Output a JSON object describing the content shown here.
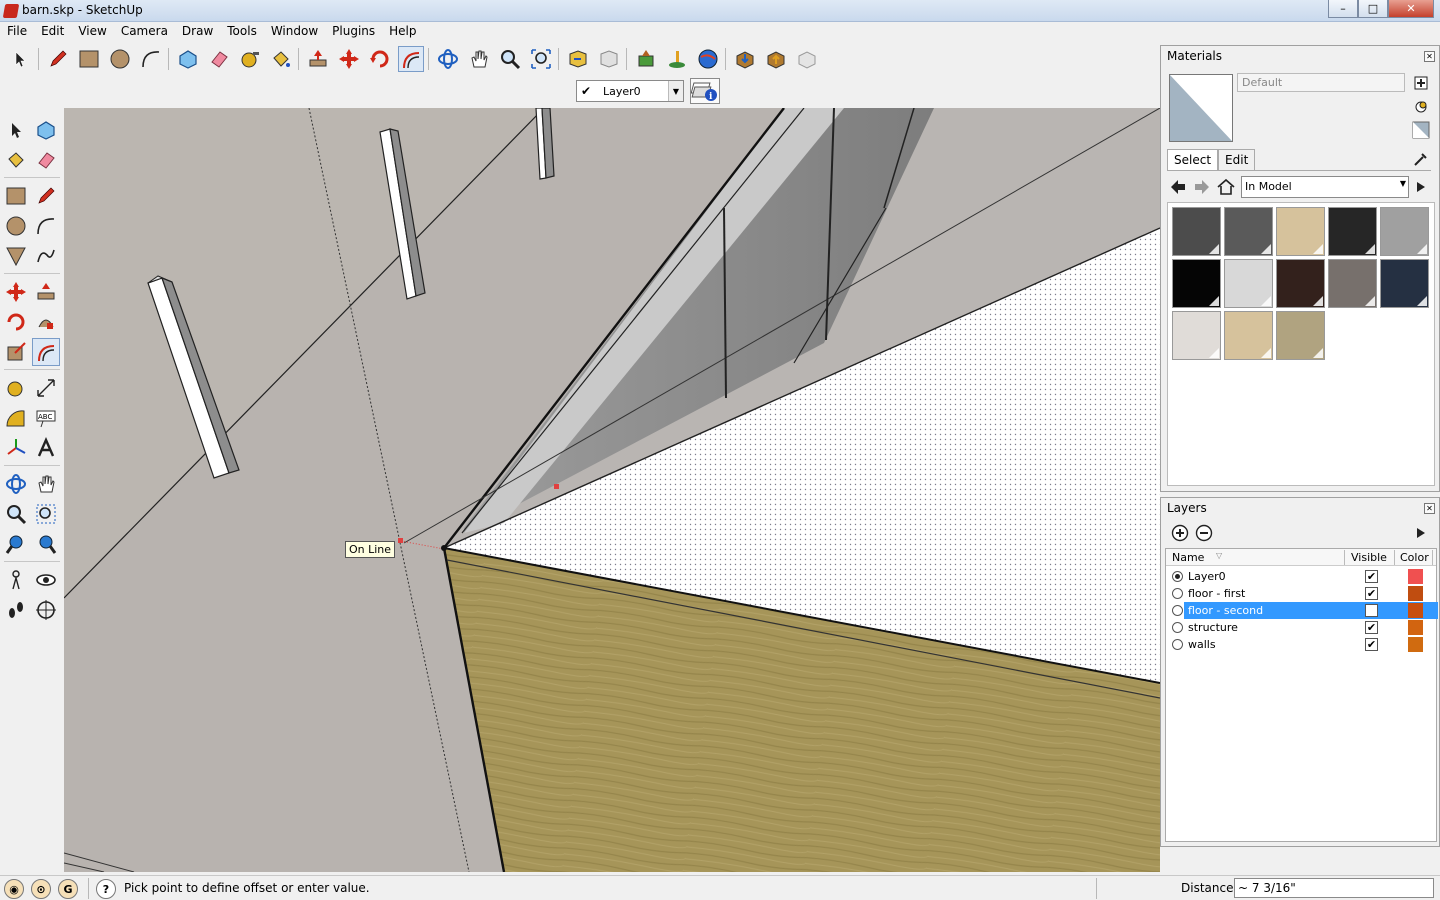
{
  "window": {
    "title": "barn.skp - SketchUp",
    "min": "–",
    "max": "□",
    "close": "✕"
  },
  "menu": [
    "File",
    "Edit",
    "View",
    "Camera",
    "Draw",
    "Tools",
    "Window",
    "Plugins",
    "Help"
  ],
  "layer_toolbar": {
    "current_layer": "Layer0"
  },
  "viewport": {
    "inference_tooltip": "On Line"
  },
  "materials": {
    "title": "Materials",
    "material_name": "Default",
    "tabs": [
      "Select",
      "Edit"
    ],
    "collection": "In Model",
    "swatches": [
      "#4c4c4c",
      "#5a5a5a",
      "#d6c29c",
      "#262626",
      "#a0a0a0",
      "#050505",
      "#d8d8d8",
      "#33211c",
      "#77706c",
      "#253042",
      "#e0dcd8",
      "#d6c29c",
      "#b0a380"
    ]
  },
  "layers": {
    "title": "Layers",
    "columns": {
      "name": "Name",
      "visible": "Visible",
      "color": "Color"
    },
    "rows": [
      {
        "name": "Layer0",
        "active": true,
        "visible": true,
        "color": "#f05050",
        "selected": false
      },
      {
        "name": "floor - first",
        "active": false,
        "visible": true,
        "color": "#c04d10",
        "selected": false
      },
      {
        "name": "floor - second",
        "active": false,
        "visible": false,
        "color": "#c84e0f",
        "selected": true
      },
      {
        "name": "structure",
        "active": false,
        "visible": true,
        "color": "#d26410",
        "selected": false
      },
      {
        "name": "walls",
        "active": false,
        "visible": true,
        "color": "#d06b10",
        "selected": false
      }
    ]
  },
  "status": {
    "message": "Pick point to define offset or enter value.",
    "measurement_label": "Distance",
    "measurement_value": "~ 7 3/16\""
  }
}
